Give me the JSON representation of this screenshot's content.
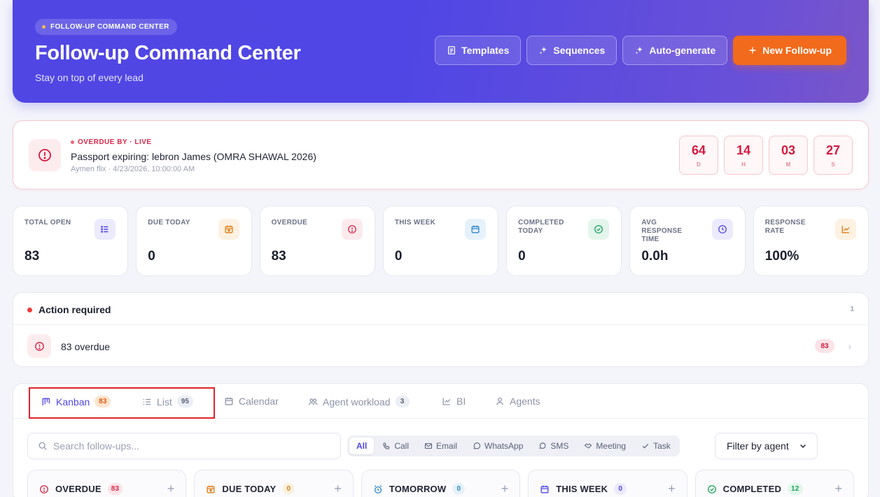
{
  "hero": {
    "badge": "FOLLOW-UP COMMAND CENTER",
    "title": "Follow-up Command Center",
    "subtitle": "Stay on top of every lead",
    "buttons": {
      "templates": "Templates",
      "sequences": "Sequences",
      "autogenerate": "Auto-generate",
      "new": "New Follow-up"
    }
  },
  "overdue": {
    "label": "OVERDUE BY · LIVE",
    "title": "Passport expiring: lebron James (OMRA SHAWAL 2026)",
    "meta": "Aymen flix · 4/23/2026, 10:00:00 AM",
    "countdown": [
      {
        "value": "64",
        "unit": "D"
      },
      {
        "value": "14",
        "unit": "H"
      },
      {
        "value": "03",
        "unit": "M"
      },
      {
        "value": "27",
        "unit": "S"
      }
    ]
  },
  "stats": [
    {
      "label": "TOTAL OPEN",
      "value": "83",
      "icon": "list-icon",
      "color": "#4f46e5",
      "bg": "#eceafd"
    },
    {
      "label": "DUE TODAY",
      "value": "0",
      "icon": "calendar-icon",
      "color": "#e07b12",
      "bg": "#fdf1e2"
    },
    {
      "label": "OVERDUE",
      "value": "83",
      "icon": "alert-circle-icon",
      "color": "#dc2646",
      "bg": "#fdeaed"
    },
    {
      "label": "THIS WEEK",
      "value": "0",
      "icon": "calendar-icon",
      "color": "#2b86c7",
      "bg": "#e6f2fb"
    },
    {
      "label": "COMPLETED TODAY",
      "value": "0",
      "icon": "check-circle-icon",
      "color": "#16a35a",
      "bg": "#e4f6ec"
    },
    {
      "label": "AVG RESPONSE TIME",
      "value": "0.0h",
      "icon": "clock-icon",
      "color": "#4f46e5",
      "bg": "#eceafd"
    },
    {
      "label": "RESPONSE RATE",
      "value": "100%",
      "icon": "trend-icon",
      "color": "#e07b12",
      "bg": "#fdf1e2"
    }
  ],
  "action": {
    "title": "Action required",
    "count": "1",
    "row_label": "83 overdue",
    "row_badge": "83"
  },
  "tabs": [
    {
      "label": "Kanban",
      "count": "83",
      "icon": "kanban-icon"
    },
    {
      "label": "List",
      "count": "95",
      "icon": "list-icon"
    },
    {
      "label": "Calendar",
      "icon": "calendar-icon"
    },
    {
      "label": "Agent workload",
      "count": "3",
      "icon": "users-icon"
    },
    {
      "label": "BI",
      "icon": "chart-icon"
    },
    {
      "label": "Agents",
      "icon": "user-icon"
    }
  ],
  "search": {
    "placeholder": "Search follow-ups..."
  },
  "filters": [
    "All",
    "Call",
    "Email",
    "WhatsApp",
    "SMS",
    "Meeting",
    "Task"
  ],
  "agent_filter": "Filter by agent",
  "columns": [
    {
      "label": "OVERDUE",
      "count": "83",
      "color": "#dc2646",
      "cbg": "#fde3e7"
    },
    {
      "label": "DUE TODAY",
      "count": "0",
      "color": "#e07b12",
      "cbg": "#fdf1e2"
    },
    {
      "label": "TOMORROW",
      "count": "0",
      "color": "#2b86c7",
      "cbg": "#e6f2fb"
    },
    {
      "label": "THIS WEEK",
      "count": "0",
      "color": "#4f46e5",
      "cbg": "#eceafd"
    },
    {
      "label": "COMPLETED",
      "count": "12",
      "color": "#16a35a",
      "cbg": "#e4f6ec"
    }
  ]
}
